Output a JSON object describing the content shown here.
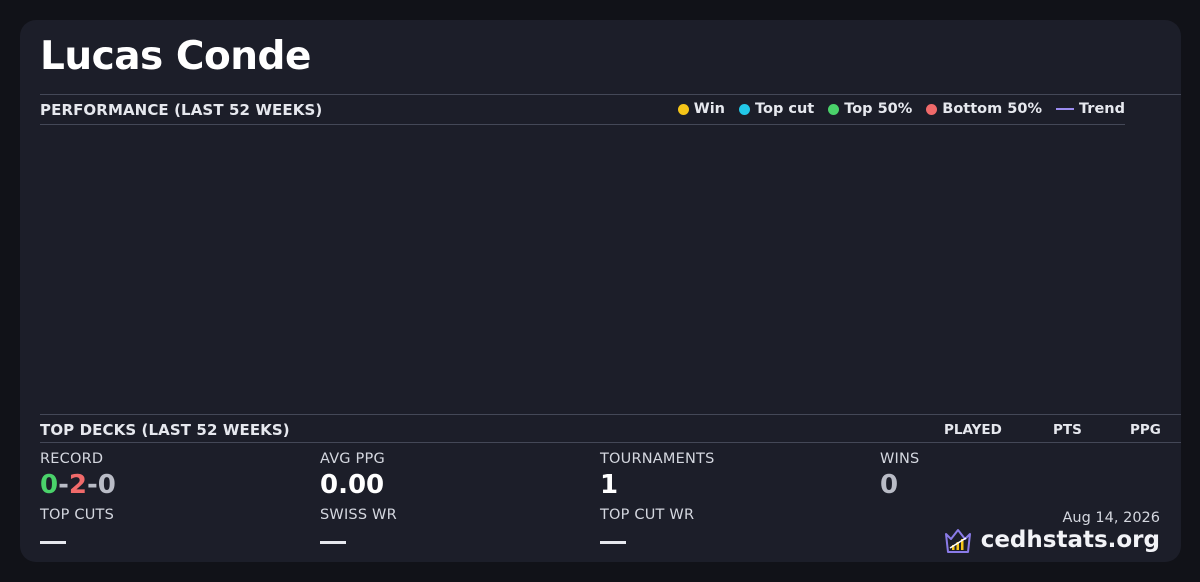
{
  "player": {
    "name": "Lucas Conde"
  },
  "performance": {
    "heading": "PERFORMANCE (LAST 52 WEEKS)",
    "legend": [
      {
        "label": "Win",
        "color": "#f5c518",
        "icon": "circle"
      },
      {
        "label": "Top cut",
        "color": "#22c8e8",
        "icon": "circle"
      },
      {
        "label": "Top 50%",
        "color": "#4ad26a",
        "icon": "circle"
      },
      {
        "label": "Bottom 50%",
        "color": "#f06a6a",
        "icon": "circle"
      },
      {
        "label": "Trend",
        "color": "#9b8cf0",
        "icon": "line"
      }
    ]
  },
  "top_decks": {
    "heading": "TOP DECKS (LAST 52 WEEKS)",
    "columns": [
      "PLAYED",
      "PTS",
      "PPG"
    ]
  },
  "stats": {
    "record": {
      "label": "RECORD",
      "wins": "0",
      "losses": "2",
      "draws": "0",
      "sep": "-"
    },
    "avg_ppg": {
      "label": "AVG PPG",
      "value": "0.00"
    },
    "tournaments": {
      "label": "TOURNAMENTS",
      "value": "1"
    },
    "wins": {
      "label": "WINS",
      "value": "0"
    },
    "top_cuts": {
      "label": "TOP CUTS",
      "value": "—"
    },
    "swiss_wr": {
      "label": "SWISS WR",
      "value": "—"
    },
    "top_cut_wr": {
      "label": "TOP CUT WR",
      "value": "—"
    }
  },
  "footer": {
    "date": "Aug 14, 2026",
    "brand": "cedhstats.org",
    "logo_icon": "crown-chart-logo-icon"
  },
  "colors": {
    "win_green": "#4ad26a",
    "loss_red": "#f06a6a",
    "draw_gray": "#b9bcc6",
    "wins_value_gray": "#b9bcc6"
  }
}
